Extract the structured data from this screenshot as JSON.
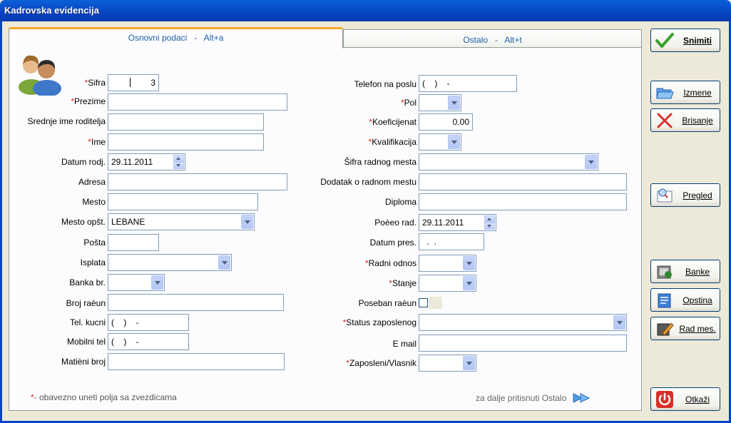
{
  "window": {
    "title": "Kadrovska evidencija"
  },
  "tabs": [
    {
      "label": "Osnovni podaci   -   Alt+a"
    },
    {
      "label": "Ostalo   -   Alt+t"
    }
  ],
  "left_fields": {
    "sifra": {
      "label": "Sifra",
      "value": "3"
    },
    "prezime": {
      "label": "Prezime",
      "value": ""
    },
    "srednje_ime": {
      "label": "Srednje ime roditelja",
      "value": ""
    },
    "ime": {
      "label": "Ime",
      "value": ""
    },
    "datum_rodj": {
      "label": "Datum rodj.",
      "value": "29.11.2011"
    },
    "adresa": {
      "label": "Adresa",
      "value": ""
    },
    "mesto": {
      "label": "Mesto",
      "value": ""
    },
    "mesto_opst": {
      "label": "Mesto opšt.",
      "value": "LEBANE"
    },
    "posta": {
      "label": "Pošta",
      "value": ""
    },
    "isplata": {
      "label": "Isplata",
      "value": ""
    },
    "banka_br": {
      "label": "Banka br.",
      "value": ""
    },
    "broj_racuna": {
      "label": "Broj raèun",
      "value": ""
    },
    "tel_kucni": {
      "label": "Tel. kucni",
      "value": "(    )    -"
    },
    "mobilni": {
      "label": "Mobilni tel",
      "value": "(    )    -"
    },
    "maticni": {
      "label": "Matièni broj",
      "value": ""
    }
  },
  "right_fields": {
    "telefon": {
      "label": "Telefon na poslu",
      "value": "(    )    -"
    },
    "pol": {
      "label": "Pol",
      "value": ""
    },
    "koeficijenat": {
      "label": "Koeficijenat",
      "value": "0.00"
    },
    "kvalifikacija": {
      "label": "Kvalifikacija",
      "value": ""
    },
    "sifra_mesta": {
      "label": "Šifra radnog mesta",
      "value": ""
    },
    "dodatak": {
      "label": "Dodatak o radnom mestu",
      "value": ""
    },
    "diploma": {
      "label": "Diploma",
      "value": ""
    },
    "pocetak": {
      "label": "Poèeo rad.",
      "value": "29.11.2011"
    },
    "datum_pres": {
      "label": "Datum pres.",
      "value": "  .  ."
    },
    "radni_odnos": {
      "label": "Radni odnos",
      "value": ""
    },
    "stanje": {
      "label": "Stanje",
      "value": ""
    },
    "poseban": {
      "label": "Poseban raèun",
      "checked": false
    },
    "status": {
      "label": "Status zaposlenog",
      "value": ""
    },
    "email": {
      "label": "E mail",
      "value": ""
    },
    "zaposleni": {
      "label": "Zaposleni/Vlasnik",
      "value": ""
    }
  },
  "required_mark": "*",
  "footnote": "- obavezno uneti polja sa zvezdicama",
  "hint": "za dalje pritisnuti Ostalo",
  "buttons": {
    "snimiti": "Snimiti",
    "izmene": "Izmene",
    "brisanje": "Brisanje",
    "pregled": "Pregled",
    "banke": "Banke",
    "opstina": "Opstina",
    "rad_mes": "Rad mes.",
    "otkazi": "Otkaži"
  },
  "icons": {
    "avatar": "users-icon",
    "hint": "double-arrow-right-icon"
  }
}
